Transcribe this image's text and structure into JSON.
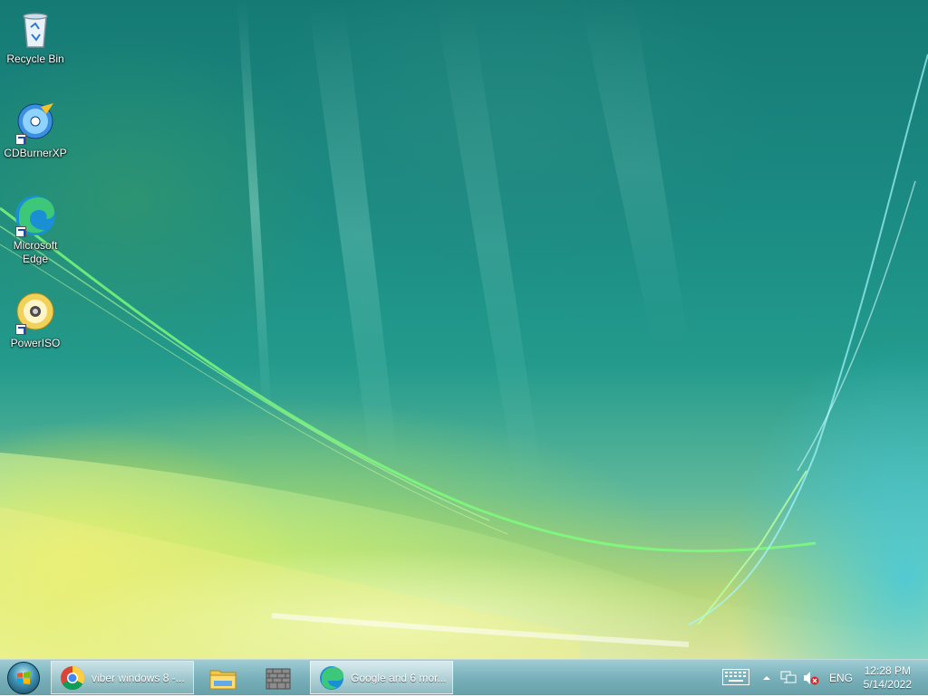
{
  "desktop": {
    "icons": [
      {
        "label": "Recycle Bin",
        "icon": "recycle-bin-icon"
      },
      {
        "label": "CDBurnerXP",
        "icon": "cdburnerxp-icon"
      },
      {
        "label": "Microsoft Edge",
        "icon": "edge-icon"
      },
      {
        "label": "PowerISO",
        "icon": "poweriso-icon"
      }
    ]
  },
  "taskbar": {
    "start_icon": "windows-start-icon",
    "pinned": [
      {
        "label": "viber windows 8 -...",
        "icon": "chrome-icon",
        "active": false
      },
      {
        "label": "",
        "icon": "file-explorer-icon"
      },
      {
        "label": "",
        "icon": "firewall-icon"
      },
      {
        "label": "Google and 6 mor...",
        "icon": "edge-icon",
        "active": true
      }
    ],
    "tray": {
      "keyboard_icon": "touch-keyboard-icon",
      "show_hidden_icon": "chevron-up-icon",
      "network_icon": "network-icon",
      "volume_icon": "volume-muted-icon",
      "language": "ENG"
    },
    "clock": {
      "time": "12:28 PM",
      "date": "5/14/2022"
    }
  },
  "colors": {
    "taskbar": "#6fa9b3",
    "wallpaper_top": "#167a74",
    "wallpaper_bottom": "#dfe39c"
  }
}
